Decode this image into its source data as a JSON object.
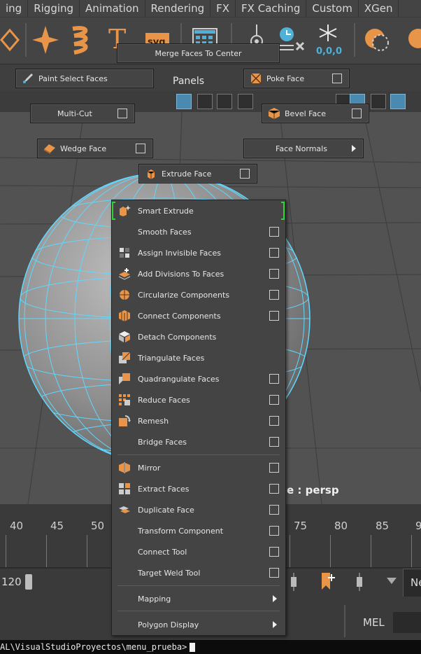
{
  "menubar": {
    "tabs": [
      "ing",
      "Rigging",
      "Animation",
      "Rendering",
      "FX",
      "FX Caching",
      "Custom",
      "XGen"
    ]
  },
  "panels": {
    "title": "Panels"
  },
  "marking_menu": {
    "merge": "Merge Faces To Center",
    "paint_select": "Paint Select Faces",
    "poke": "Poke Face",
    "multi_cut": "Multi-Cut",
    "bevel": "Bevel Face",
    "wedge": "Wedge Face",
    "face_normals": "Face Normals",
    "extrude": "Extrude Face"
  },
  "dropdown": {
    "items": [
      {
        "label": "Smart Extrude",
        "icon": "smart-extrude-icon",
        "option": false
      },
      {
        "label": "Smooth Faces",
        "icon": "",
        "option": true
      },
      {
        "label": "Assign Invisible Faces",
        "icon": "assign-invisible-faces-icon",
        "option": true
      },
      {
        "label": "Add Divisions To Faces",
        "icon": "add-divisions-icon",
        "option": true
      },
      {
        "label": "Circularize Components",
        "icon": "circularize-icon",
        "option": true
      },
      {
        "label": "Connect Components",
        "icon": "connect-components-icon",
        "option": true
      },
      {
        "label": "Detach Components",
        "icon": "detach-components-icon",
        "option": false
      },
      {
        "label": "Triangulate Faces",
        "icon": "triangulate-icon",
        "option": false
      },
      {
        "label": "Quadrangulate Faces",
        "icon": "quadrangulate-icon",
        "option": true
      },
      {
        "label": "Reduce Faces",
        "icon": "reduce-faces-icon",
        "option": true
      },
      {
        "label": "Remesh",
        "icon": "remesh-icon",
        "option": true
      },
      {
        "label": "Bridge Faces",
        "icon": "",
        "option": true
      },
      {
        "label": "Mirror",
        "icon": "mirror-icon",
        "option": true
      },
      {
        "label": "Extract Faces",
        "icon": "extract-faces-icon",
        "option": true
      },
      {
        "label": "Duplicate Face",
        "icon": "duplicate-face-icon",
        "option": true
      },
      {
        "label": "Transform Component",
        "icon": "",
        "option": true
      },
      {
        "label": "Connect Tool",
        "icon": "",
        "option": true
      },
      {
        "label": "Target Weld Tool",
        "icon": "",
        "option": true
      },
      {
        "label": "Mapping",
        "icon": "",
        "submenu": true
      },
      {
        "label": "Polygon Display",
        "icon": "",
        "submenu": true
      }
    ]
  },
  "viewport": {
    "camera_label": "e : persp"
  },
  "timeline": {
    "ticks": [
      "40",
      "45",
      "50",
      "75",
      "80",
      "85",
      "9"
    ]
  },
  "range": {
    "value": "120"
  },
  "command": {
    "mel_label": "MEL",
    "ne_label": "Ne"
  },
  "console": {
    "path": "AL\\VisualStudioProyectos\\menu_prueba>"
  },
  "colors": {
    "accent_orange": "#e8954a",
    "wire_cyan": "#5fd8ff",
    "selection_green": "#36d13a"
  }
}
